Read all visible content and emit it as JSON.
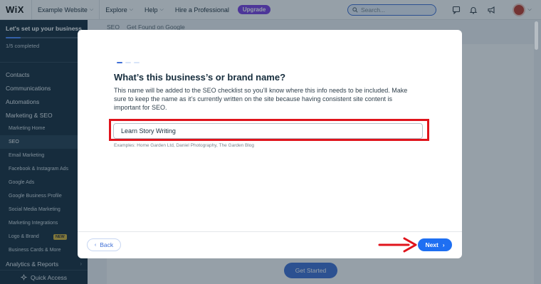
{
  "topbar": {
    "logo": "WiX",
    "site_name": "Example Website",
    "explore": "Explore",
    "help": "Help",
    "hire": "Hire a Professional",
    "upgrade": "Upgrade",
    "search_placeholder": "Search..."
  },
  "sidebar": {
    "setup_title": "Let's set up your business",
    "setup_progress": "1/5 completed",
    "progress_fraction": 0.2,
    "items": [
      {
        "label": "Contacts"
      },
      {
        "label": "Communications"
      },
      {
        "label": "Automations"
      },
      {
        "label": "Marketing & SEO"
      }
    ],
    "sub_items": [
      {
        "label": "Marketing Home"
      },
      {
        "label": "SEO"
      },
      {
        "label": "Email Marketing"
      },
      {
        "label": "Facebook & Instagram Ads"
      },
      {
        "label": "Google Ads"
      },
      {
        "label": "Google Business Profile"
      },
      {
        "label": "Social Media Marketing"
      },
      {
        "label": "Marketing Integrations"
      },
      {
        "label": "Logo & Brand"
      },
      {
        "label": "Business Cards & More"
      }
    ],
    "new_badge": "NEW",
    "analytics": "Analytics & Reports",
    "quick_access": "Quick Access"
  },
  "page": {
    "breadcrumb_root": "SEO",
    "breadcrumb_current": "Get Found on Google",
    "get_started": "Get Started"
  },
  "modal": {
    "title": "What’s this business’s or brand name?",
    "description": "This name will be added to the SEO checklist so you’ll know where this info needs to be included. Make sure to keep the name as it’s currently written on the site because having consistent site content is important for SEO.",
    "input_value": "Learn Story Writing",
    "examples": "Examples: Home Garden Ltd, Daniel Photography, The Garden Blog",
    "back_label": "Back",
    "next_label": "Next"
  },
  "colors": {
    "accent": "#1e6ff2",
    "sidebar_bg": "#162d3d",
    "highlight": "#e0141c",
    "upgrade": "#7b3fe4"
  }
}
